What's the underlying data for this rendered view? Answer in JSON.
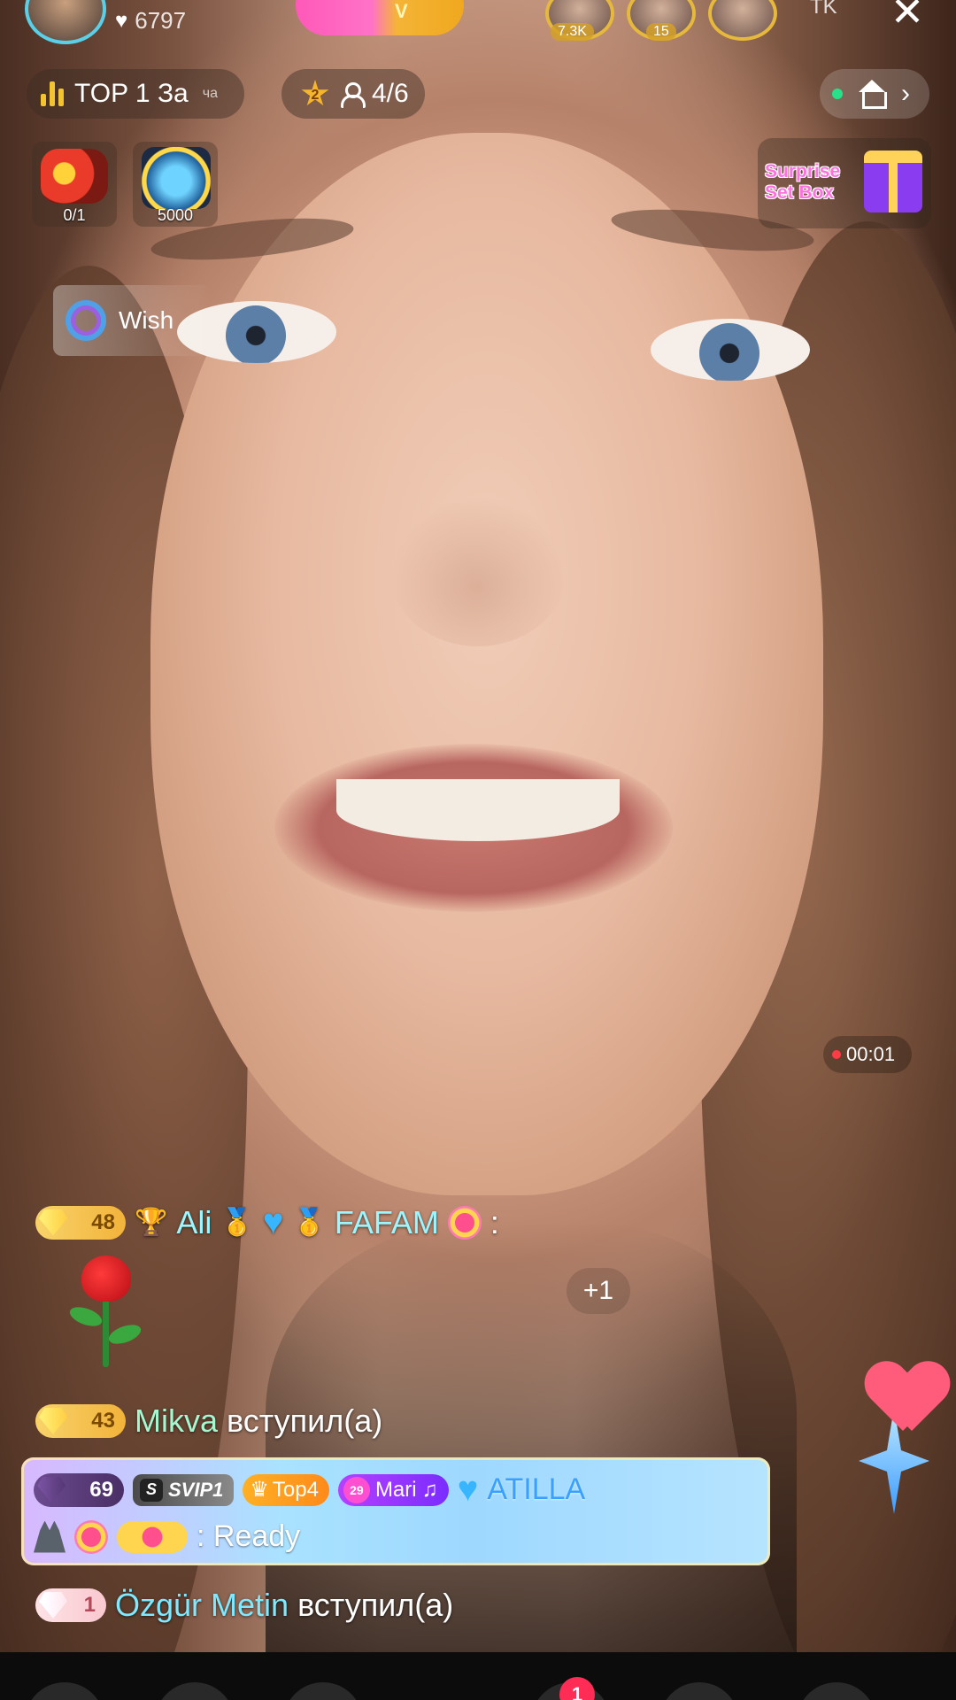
{
  "header": {
    "likes_count": "6797",
    "host_level": "V",
    "viewers": [
      {
        "count": "7.3K"
      },
      {
        "count": "15"
      },
      {
        "count": ""
      }
    ],
    "tk_label": "TK",
    "close_label": "✕"
  },
  "room_bar": {
    "rank_label": "TOP 1 За",
    "rank_suffix": "ча",
    "level_badge": "2",
    "guests": "4/6",
    "online_status_color": "#27e08a"
  },
  "badges": [
    {
      "icon": "dragon-icon",
      "label": "0/1"
    },
    {
      "icon": "helmet-icon",
      "label": "5000"
    }
  ],
  "surprise_box": {
    "line1": "Surprise",
    "line2": "Set Box"
  },
  "wish": {
    "label": "Wish"
  },
  "recording": {
    "time": "00:01"
  },
  "chat": [
    {
      "level": "48",
      "name": "Ali",
      "name2": "FAFAM",
      "suffix": ":"
    },
    {
      "level": "43",
      "name": "Mikva",
      "action": "вступил(а)"
    },
    {
      "level": "69",
      "svip": "SVIP1",
      "top": "Top4",
      "fan_level": "29",
      "fan_name": "Mari",
      "name": "ATILLA",
      "message": ": Ready"
    },
    {
      "level": "1",
      "name": "Özgür Metin",
      "action": "вступил(а)"
    }
  ],
  "plus_one": "+1",
  "bottom": {
    "notification_count": "1"
  }
}
